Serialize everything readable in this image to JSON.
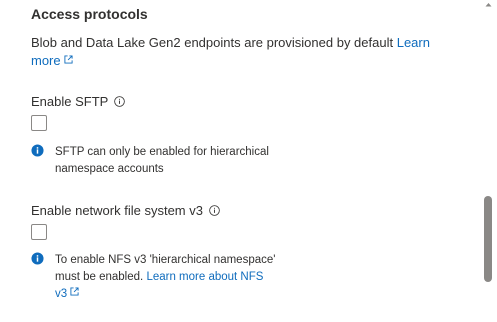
{
  "section": {
    "title": "Access protocols",
    "description": "Blob and Data Lake Gen2 endpoints are provisioned by default",
    "learn_more_label": "Learn more"
  },
  "sftp": {
    "label": "Enable SFTP",
    "checked": false,
    "info_line1": "SFTP can only be enabled for hierarchical",
    "info_line2": "namespace accounts"
  },
  "nfs": {
    "label": "Enable network file system v3",
    "checked": false,
    "info_line1": "To enable NFS v3 'hierarchical namespace'",
    "info_line2_prefix": "must be enabled.",
    "info_link": "Learn more about NFS",
    "info_link_tail": "v3"
  },
  "colors": {
    "link": "#0f6cbd",
    "info_icon": "#0f6cbd",
    "checkbox_border": "#8a8886",
    "scroll_thumb": "#8a8886"
  }
}
